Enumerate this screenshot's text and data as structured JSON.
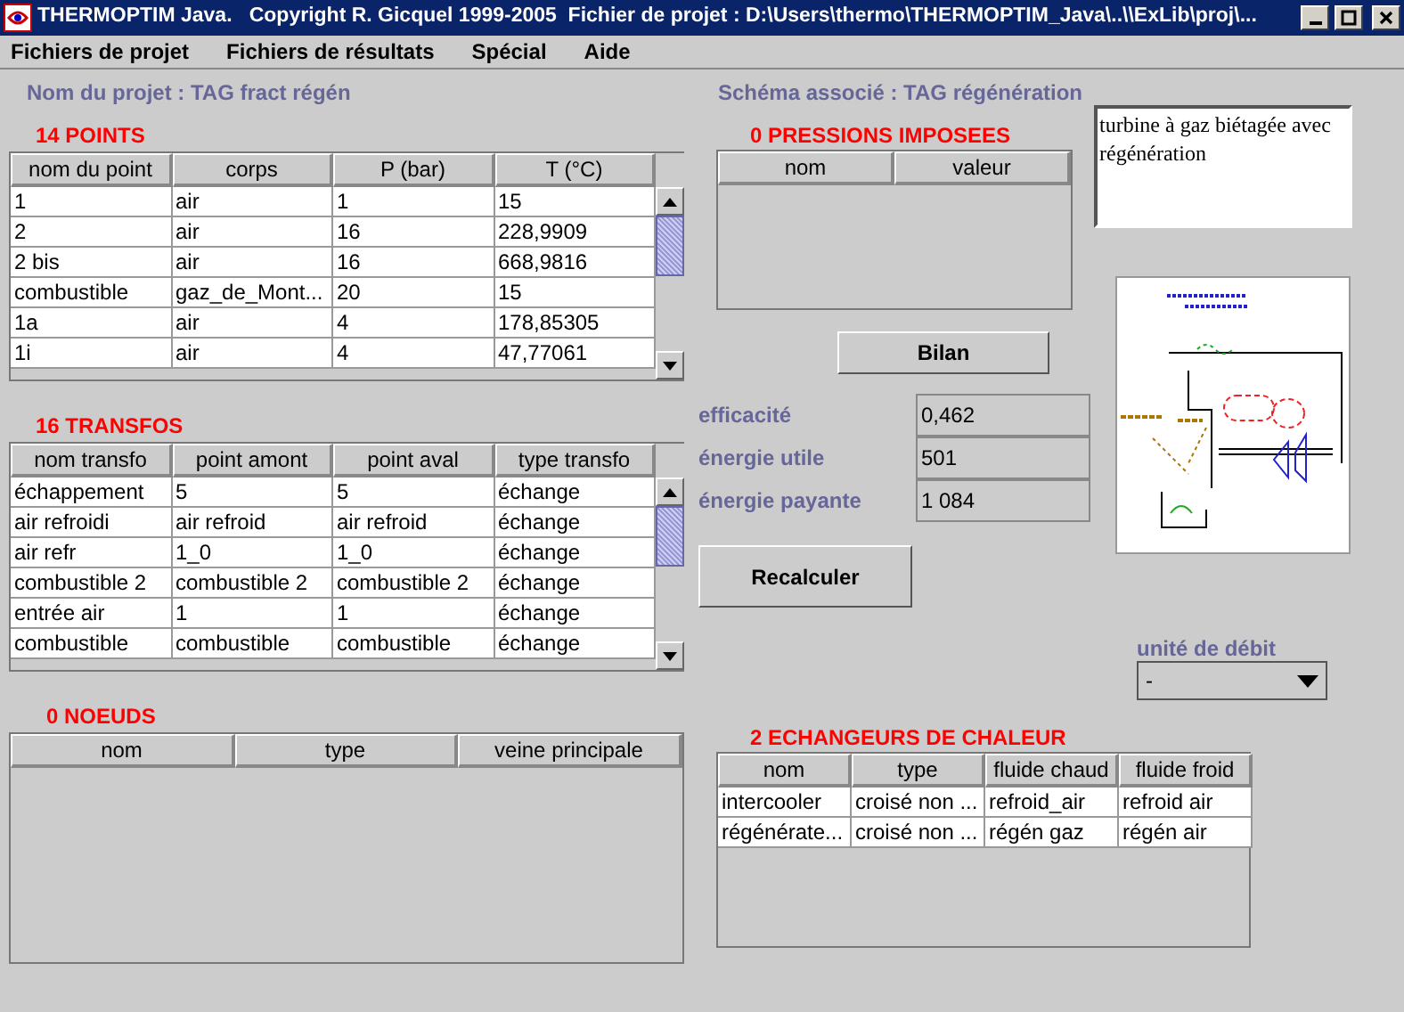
{
  "window": {
    "title": "THERMOPTIM Java.   Copyright R. Gicquel 1999-2005  Fichier de projet : D:\\Users\\thermo\\THERMOPTIM_Java\\..\\\\ExLib\\proj\\..."
  },
  "menu": [
    "Fichiers de projet",
    "Fichiers de résultats",
    "Spécial",
    "Aide"
  ],
  "project_name": "Nom du projet : TAG fract régén",
  "schema_name": "Schéma associé : TAG régénération",
  "points": {
    "title": "14  POINTS",
    "columns": [
      "nom du point",
      "corps",
      "P (bar)",
      "T (°C)"
    ],
    "rows": [
      [
        "1",
        "air",
        "1",
        "15"
      ],
      [
        "2",
        "air",
        "16",
        "228,9909"
      ],
      [
        "2 bis",
        "air",
        "16",
        "668,9816"
      ],
      [
        "combustible",
        "gaz_de_Mont...",
        "20",
        "15"
      ],
      [
        "1a",
        "air",
        "4",
        "178,85305"
      ],
      [
        "1i",
        "air",
        "4",
        "47,77061"
      ]
    ]
  },
  "transfos": {
    "title": "16  TRANSFOS",
    "columns": [
      "nom transfo",
      "point amont",
      "point aval",
      "type transfo"
    ],
    "rows": [
      [
        "échappement",
        "5",
        "5",
        "échange"
      ],
      [
        "air refroidi",
        "air refroid",
        "air refroid",
        "échange"
      ],
      [
        "air refr",
        "1_0",
        "1_0",
        "échange"
      ],
      [
        "combustible 2",
        "combustible 2",
        "combustible 2",
        "échange"
      ],
      [
        "entrée air",
        "1",
        "1",
        "échange"
      ],
      [
        "combustible",
        "combustible",
        "combustible",
        "échange"
      ]
    ]
  },
  "noeuds": {
    "title": "0  NOEUDS",
    "columns": [
      "nom",
      "type",
      "veine principale"
    ]
  },
  "pressions": {
    "title": "0  PRESSIONS IMPOSEES",
    "columns": [
      "nom",
      "valeur"
    ]
  },
  "description": "turbine à gaz biétagée avec régénération",
  "bilan_button": "Bilan",
  "results": [
    {
      "label": "efficacité",
      "value": "0,462"
    },
    {
      "label": "énergie utile",
      "value": "501"
    },
    {
      "label": "énergie payante",
      "value": "1 084"
    }
  ],
  "recalc_button": "Recalculer",
  "flow_unit": {
    "label": "unité de débit",
    "value": "-"
  },
  "echangeurs": {
    "title": "2  ECHANGEURS DE CHALEUR",
    "columns": [
      "nom",
      "type",
      "fluide chaud",
      "fluide froid"
    ],
    "rows": [
      [
        "intercooler",
        "croisé non ...",
        "refroid_air",
        "refroid air"
      ],
      [
        "régénérate...",
        "croisé non ...",
        "régén gaz",
        "régén air"
      ]
    ]
  }
}
